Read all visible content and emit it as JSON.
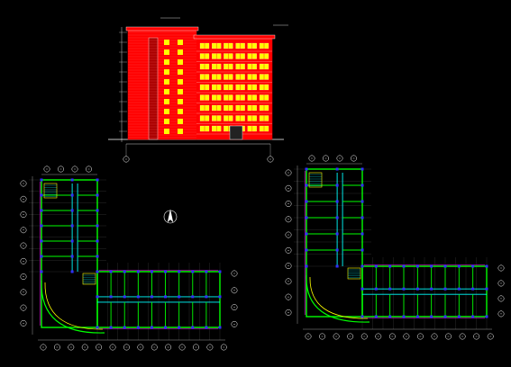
{
  "colors": {
    "background": "#000000",
    "brick_red": "#ff0000",
    "window_yellow": "#ffff00",
    "wall_green": "#00ff00",
    "wall_cyan": "#00ffff",
    "column_blue": "#3030ff",
    "wall_magenta": "#ff00ff",
    "line_white": "#ffffff",
    "tag_blue": "#0000ff"
  },
  "views": {
    "elevation": {
      "title": "",
      "scale": "",
      "floors": 9,
      "window_columns": 6
    },
    "plan_left": {
      "title": "",
      "scale": ""
    },
    "plan_right": {
      "title": "",
      "scale": ""
    }
  },
  "icons": {
    "north_arrow": "north-arrow-icon",
    "axis_bubble": "axis-bubble-icon"
  }
}
